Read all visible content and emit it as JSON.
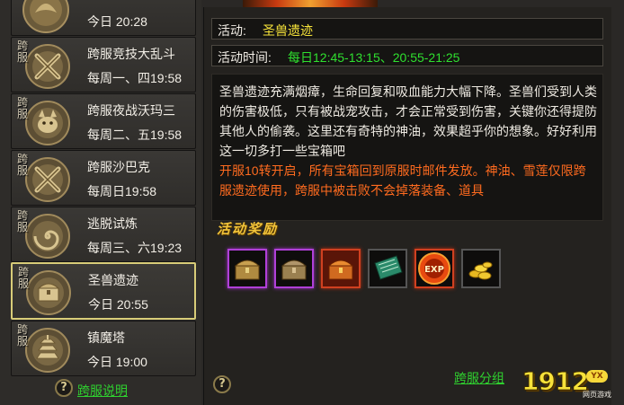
{
  "events": [
    {
      "kuafu": "",
      "name": "",
      "time": "今日 20:28",
      "medal": "dragon"
    },
    {
      "kuafu": "跨服",
      "name": "跨服竞技大乱斗",
      "time": "每周一、四19:58",
      "medal": "swords"
    },
    {
      "kuafu": "跨服",
      "name": "跨服夜战沃玛三",
      "time": "每周二、五19:58",
      "medal": "beast"
    },
    {
      "kuafu": "跨服",
      "name": "跨服沙巴克",
      "time": "每周日19:58",
      "medal": "swords"
    },
    {
      "kuafu": "跨服",
      "name": "逃脱试炼",
      "time": "每周三、六19:23",
      "medal": "spiral"
    },
    {
      "kuafu": "跨服",
      "name": "圣兽遗迹",
      "time": "今日 20:55",
      "medal": "chest"
    },
    {
      "kuafu": "跨服",
      "name": "镇魔塔",
      "time": "今日 19:00",
      "medal": "tower"
    }
  ],
  "left_help_symbol": "?",
  "kuafu_help_label": "跨服说明",
  "activity": {
    "name_label": "活动:",
    "name_value": "圣兽遗迹",
    "time_label": "活动时间:",
    "time_value": "每日12:45-13:15、20:55-21:25",
    "description": "圣兽遗迹充满烟瘴，生命回复和吸血能力大幅下降。圣兽们受到人类的伤害极低，只有被战宠攻击，才会正常受到伤害，关键你还得提防其他人的偷袭。这里还有奇特的神油，效果超乎你的想象。好好利用这一切多打一些宝箱吧",
    "note": "开服10转开启，所有宝箱回到原服时邮件发放。神油、雪莲仅限跨服遗迹使用，跨服中被击败不会掉落装备、道具"
  },
  "reward_title": "活动奖励",
  "rewards": [
    {
      "icon": "purple-chest-icon",
      "rarity": "purple"
    },
    {
      "icon": "purple-chest-icon",
      "rarity": "purple"
    },
    {
      "icon": "red-chest-icon",
      "rarity": "red"
    },
    {
      "icon": "book-icon",
      "rarity": "normal"
    },
    {
      "icon": "exp-orb-icon",
      "rarity": "normal"
    },
    {
      "icon": "gold-coins-icon",
      "rarity": "normal"
    }
  ],
  "right_help_symbol": "?",
  "kuafu_group_label": "跨服分组",
  "logo": {
    "number": "1912",
    "badge": "YX",
    "subtitle": "网页游戏"
  },
  "colors": {
    "selected_border": "#d8cc78",
    "link_green": "#2fd12f",
    "highlight_yellow": "#f7e43a",
    "note_orange": "#ff6b1f"
  }
}
